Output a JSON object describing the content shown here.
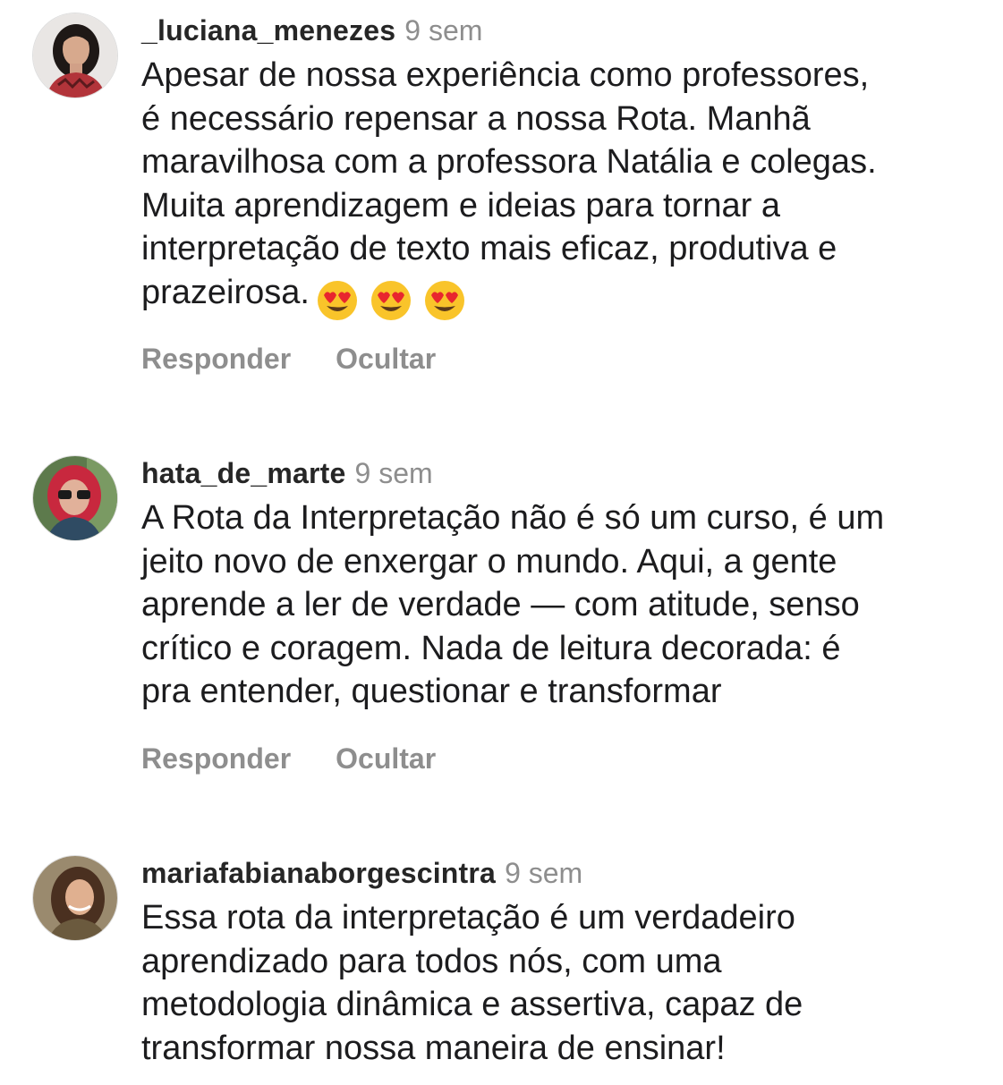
{
  "comments": [
    {
      "username": "_luciana_menezes",
      "time": "9 sem",
      "text": "Apesar de nossa experiência como professores,\né necessário repensar a nossa Rota. Manhã\nmaravilhosa com a professora Natália e colegas.\nMuita aprendizagem e ideias para tornar a\ninterpretação de texto mais eficaz, produtiva e\nprazeirosa.",
      "emojis": [
        "heart-eyes-emoji",
        "heart-eyes-emoji",
        "heart-eyes-emoji"
      ],
      "reply_label": "Responder",
      "hide_label": "Ocultar"
    },
    {
      "username": "hata_de_marte",
      "time": "9 sem",
      "text": "A Rota da Interpretação não é só um curso, é um\njeito novo de enxergar o mundo. Aqui, a gente\naprende a ler de verdade — com atitude, senso\ncrítico e coragem. Nada de leitura decorada: é\npra entender, questionar e transformar",
      "reply_label": "Responder",
      "hide_label": "Ocultar"
    },
    {
      "username": "mariafabianaborgescintra",
      "time": "9 sem",
      "text": "Essa rota da interpretação é um verdadeiro\naprendizado para todos nós, com uma\nmetodologia dinâmica e assertiva, capaz de\ntransformar nossa maneira de ensinar!"
    }
  ],
  "colors": {
    "username": "#262626",
    "muted": "#8e8e8e",
    "text": "#1c1c1e"
  }
}
